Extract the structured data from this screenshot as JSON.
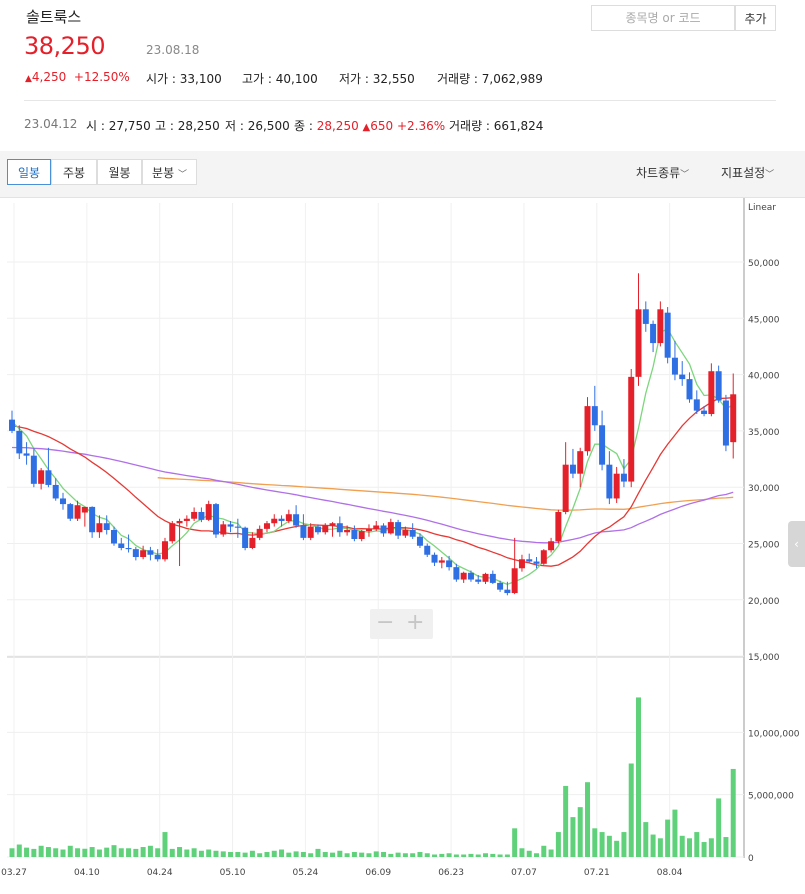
{
  "header": {
    "stock_name": "솔트룩스",
    "price": "38,250",
    "date": "23.08.18",
    "change_amount": "4,250",
    "change_pct": "+12.50%",
    "open_label": "시가 : ",
    "open": "33,100",
    "high_label": "고가 : ",
    "high": "40,100",
    "low_label": "저가 : ",
    "low": "32,550",
    "volume_label": "거래량 : ",
    "volume": "7,062,989"
  },
  "search": {
    "placeholder": "종목명 or 코드",
    "add_label": "추가"
  },
  "hover": {
    "date": "23.04.12",
    "open_label": "시 : ",
    "open": "27,750",
    "high_label": "고 : ",
    "high": "28,250",
    "low_label": "저 : ",
    "low": "26,500",
    "close_label": "종 : ",
    "close": "28,250",
    "change": "650",
    "change_pct": "+2.36%",
    "volume_label": "거래량 : ",
    "volume": "661,824"
  },
  "tabs": [
    "일봉",
    "주봉",
    "월봉",
    "분봉"
  ],
  "right_tools": {
    "chart_type": "차트종류",
    "indicator": "지표설정"
  },
  "colors": {
    "up": "#e4202a",
    "down": "#2f6fe4",
    "volume": "#5fd17a",
    "ma5": "#7cd67c",
    "ma20": "#e53935",
    "ma60": "#b070e8",
    "ma120": "#f0a050"
  },
  "chart_data": {
    "type": "candlestick",
    "scale": "Linear",
    "price_range": [
      15000,
      54000
    ],
    "price_ticks": [
      "50,000",
      "45,000",
      "40,000",
      "35,000",
      "30,000",
      "25,000",
      "20,000",
      "15,000"
    ],
    "volume_range": [
      0,
      15000000
    ],
    "volume_ticks": [
      "10,000,000",
      "5,000,000",
      "0"
    ],
    "x_ticks": [
      "03.27",
      "04.10",
      "04.24",
      "05.10",
      "05.24",
      "06.09",
      "06.23",
      "07.07",
      "07.21",
      "08.04"
    ],
    "x_tick_index": [
      0,
      10,
      20,
      30,
      40,
      50,
      60,
      70,
      80,
      90
    ],
    "candles": [
      [
        36000,
        36800,
        34800,
        35000
      ],
      [
        35000,
        35500,
        32500,
        33000
      ],
      [
        33000,
        34000,
        32000,
        32800
      ],
      [
        32800,
        33500,
        30000,
        30300
      ],
      [
        30300,
        31700,
        29800,
        31500
      ],
      [
        31500,
        33500,
        30000,
        30200
      ],
      [
        30200,
        30800,
        28800,
        29000
      ],
      [
        29000,
        29500,
        28000,
        28500
      ],
      [
        28500,
        28600,
        27000,
        27200
      ],
      [
        27200,
        28800,
        27000,
        28400
      ],
      [
        27750,
        28250,
        26500,
        28250
      ],
      [
        28250,
        28300,
        25500,
        26000
      ],
      [
        26000,
        27500,
        25500,
        26800
      ],
      [
        26800,
        27500,
        25800,
        26200
      ],
      [
        26200,
        26500,
        24800,
        25000
      ],
      [
        25000,
        25500,
        24400,
        24600
      ],
      [
        24600,
        25800,
        24200,
        24500
      ],
      [
        24500,
        24700,
        23500,
        23800
      ],
      [
        23800,
        24800,
        23600,
        24400
      ],
      [
        24400,
        24700,
        23500,
        24000
      ],
      [
        24000,
        24500,
        23400,
        23600
      ],
      [
        23600,
        25500,
        23400,
        25200
      ],
      [
        25200,
        27000,
        25000,
        26800
      ],
      [
        26800,
        27200,
        23000,
        27000
      ],
      [
        27000,
        27500,
        26500,
        27200
      ],
      [
        27200,
        28200,
        27000,
        27800
      ],
      [
        27800,
        28200,
        26900,
        27100
      ],
      [
        27100,
        28800,
        27000,
        28500
      ],
      [
        28500,
        28600,
        25500,
        25800
      ],
      [
        25800,
        27000,
        25600,
        26700
      ],
      [
        26700,
        27000,
        26000,
        26500
      ],
      [
        26500,
        27200,
        25500,
        26400
      ],
      [
        26400,
        26500,
        24400,
        24600
      ],
      [
        24600,
        26000,
        24500,
        25500
      ],
      [
        25500,
        26600,
        25300,
        26300
      ],
      [
        26300,
        27000,
        26000,
        26800
      ],
      [
        26800,
        27600,
        26500,
        27200
      ],
      [
        27200,
        27500,
        26500,
        27000
      ],
      [
        27000,
        28000,
        26800,
        27600
      ],
      [
        27600,
        28400,
        26400,
        26600
      ],
      [
        26600,
        27600,
        25300,
        25500
      ],
      [
        25500,
        26800,
        25300,
        26500
      ],
      [
        26500,
        26700,
        25800,
        26000
      ],
      [
        26000,
        26800,
        25800,
        26600
      ],
      [
        26600,
        26900,
        25600,
        26800
      ],
      [
        26800,
        27400,
        25600,
        26000
      ],
      [
        26000,
        26600,
        25700,
        26200
      ],
      [
        26200,
        26600,
        25200,
        25400
      ],
      [
        25400,
        26200,
        25200,
        26100
      ],
      [
        26100,
        26700,
        25600,
        26300
      ],
      [
        26300,
        27000,
        26100,
        26600
      ],
      [
        26600,
        26800,
        25600,
        25900
      ],
      [
        25900,
        27200,
        25800,
        26900
      ],
      [
        26900,
        27100,
        25400,
        25700
      ],
      [
        25700,
        26500,
        25500,
        26200
      ],
      [
        26200,
        26800,
        25400,
        25600
      ],
      [
        25600,
        25900,
        24600,
        24800
      ],
      [
        24800,
        25000,
        23800,
        24000
      ],
      [
        24000,
        24200,
        23000,
        23300
      ],
      [
        23300,
        23800,
        22800,
        23500
      ],
      [
        23500,
        23900,
        22600,
        22900
      ],
      [
        22900,
        23200,
        21600,
        21800
      ],
      [
        21800,
        22500,
        21500,
        22400
      ],
      [
        22400,
        22600,
        21600,
        21800
      ],
      [
        21800,
        22200,
        21400,
        21600
      ],
      [
        21600,
        22400,
        21400,
        22300
      ],
      [
        22300,
        22600,
        21400,
        21500
      ],
      [
        21500,
        21700,
        20700,
        20900
      ],
      [
        20900,
        21600,
        20400,
        20600
      ],
      [
        20600,
        25500,
        20500,
        22800
      ],
      [
        22800,
        24000,
        22500,
        23600
      ],
      [
        23600,
        24100,
        23300,
        23400
      ],
      [
        23400,
        23800,
        22800,
        23200
      ],
      [
        23200,
        24500,
        23100,
        24400
      ],
      [
        24400,
        25500,
        24200,
        25200
      ],
      [
        25200,
        28000,
        25000,
        27800
      ],
      [
        27800,
        34000,
        27600,
        32000
      ],
      [
        32000,
        33400,
        30800,
        31200
      ],
      [
        31200,
        33500,
        30000,
        33200
      ],
      [
        33200,
        38000,
        32800,
        37200
      ],
      [
        37200,
        39000,
        35000,
        35500
      ],
      [
        35500,
        36800,
        31500,
        32000
      ],
      [
        32000,
        33200,
        28500,
        29000
      ],
      [
        29000,
        31800,
        28600,
        31200
      ],
      [
        31200,
        32500,
        30000,
        30500
      ],
      [
        30500,
        40500,
        30000,
        39800
      ],
      [
        39800,
        49000,
        39000,
        45800
      ],
      [
        45800,
        46500,
        43800,
        44500
      ],
      [
        44500,
        44800,
        42000,
        42800
      ],
      [
        42800,
        46500,
        42500,
        45800
      ],
      [
        45500,
        46000,
        41000,
        41500
      ],
      [
        41500,
        43000,
        39500,
        40000
      ],
      [
        40000,
        41200,
        39000,
        39600
      ],
      [
        39600,
        40200,
        37500,
        37800
      ],
      [
        37800,
        38600,
        36500,
        36800
      ],
      [
        36800,
        37200,
        36300,
        36500
      ],
      [
        36500,
        41000,
        36300,
        40300
      ],
      [
        40300,
        40800,
        37500,
        37700
      ],
      [
        37700,
        38200,
        33200,
        33700
      ],
      [
        34000,
        40100,
        32550,
        38250
      ]
    ],
    "volumes": [
      700,
      1000,
      750,
      650,
      900,
      800,
      700,
      600,
      900,
      700,
      661.824,
      800,
      600,
      750,
      950,
      700,
      700,
      650,
      800,
      900,
      700,
      2000,
      650,
      800,
      600,
      700,
      500,
      600,
      500,
      450,
      400,
      400,
      350,
      500,
      300,
      400,
      500,
      600,
      350,
      450,
      400,
      300,
      650,
      400,
      350,
      500,
      300,
      400,
      350,
      300,
      450,
      400,
      250,
      350,
      300,
      300,
      400,
      300,
      200,
      250,
      300,
      200,
      200,
      250,
      200,
      300,
      250,
      200,
      200,
      2300,
      700,
      500,
      300,
      900,
      600,
      2000,
      5700,
      3200,
      4000,
      6000,
      2300,
      2000,
      1700,
      1300,
      2000,
      7500,
      12800,
      2800,
      1800,
      1500,
      3000,
      3800,
      1700,
      1500,
      2000,
      1200,
      1500,
      4700,
      1600,
      7063
    ]
  }
}
